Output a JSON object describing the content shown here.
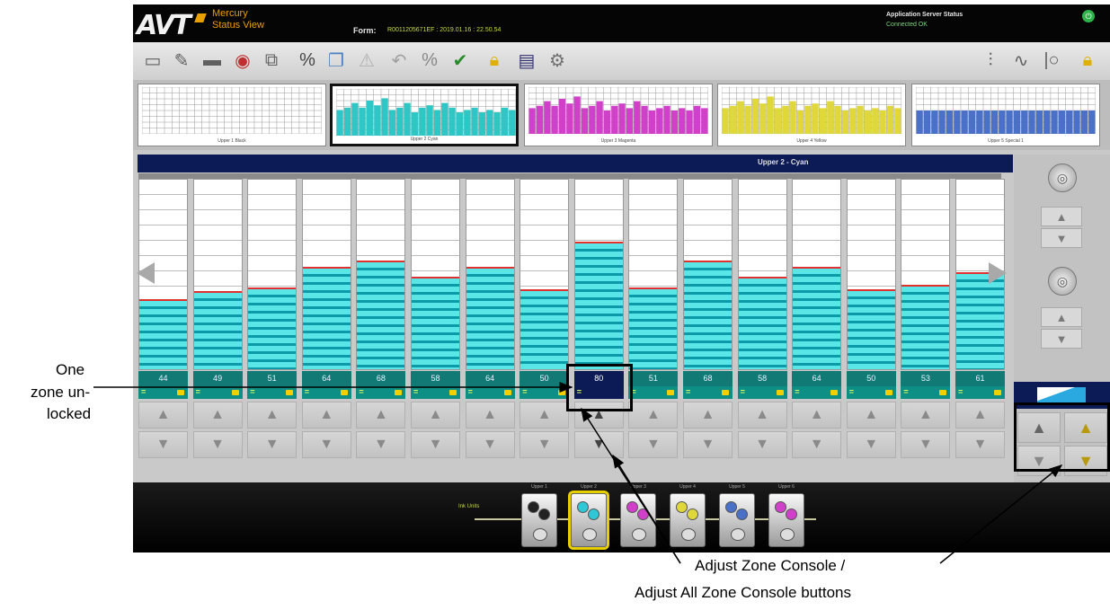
{
  "header": {
    "app_title_line1": "Mercury",
    "app_title_line2": "Status View",
    "form_label": "Form:",
    "form_value": "R0011205671EF : 2019.01.16 : 22.50.54",
    "server_status_title": "Application Server Status",
    "server_status_value": "Connected OK"
  },
  "toolbar": {
    "left_icons": [
      "new-doc-icon",
      "edit-icon",
      "save-icon",
      "record-icon",
      "export-icon",
      "percent-icon",
      "copy-icon",
      "warning-icon",
      "undo-icon",
      "percent-adjust-icon",
      "check-icon",
      "lock-icon",
      "ink-icon",
      "settings-icon"
    ],
    "right_icons": [
      "sliders-icon",
      "curve-icon",
      "io-icon",
      "lock-icon"
    ]
  },
  "thumbnails": [
    {
      "label": "Upper 1 Black",
      "color": "#444444"
    },
    {
      "label": "Upper 2 Cyan",
      "color": "#2fc6c6"
    },
    {
      "label": "Upper 3 Magenta",
      "color": "#d040c8"
    },
    {
      "label": "Upper 4 Yellow",
      "color": "#e0d83a"
    },
    {
      "label": "Upper 5 Special 1",
      "color": "#4a70c8"
    }
  ],
  "main": {
    "title": "Upper 2 - Cyan",
    "zones": [
      44,
      49,
      51,
      64,
      68,
      58,
      64,
      50,
      80,
      51,
      68,
      58,
      64,
      50,
      53,
      61
    ],
    "unlocked_zone_index": 8
  },
  "bottom": {
    "label": "Ink Units",
    "units": [
      {
        "label": "Upper 1",
        "colors": [
          "#222222",
          "#222222"
        ]
      },
      {
        "label": "Upper 2",
        "colors": [
          "#2fc6d6",
          "#2fc6d6"
        ]
      },
      {
        "label": "Upper 3",
        "colors": [
          "#d040c8",
          "#d040c8"
        ]
      },
      {
        "label": "Upper 4",
        "colors": [
          "#e0d83a",
          "#e0d83a"
        ]
      },
      {
        "label": "Upper 5",
        "colors": [
          "#4a70c8",
          "#4a70c8"
        ]
      },
      {
        "label": "Upper 6",
        "colors": [
          "#d040c8",
          "#d040c8"
        ]
      }
    ],
    "active_unit_index": 1
  },
  "annotations": {
    "one_zone_line1": "One",
    "one_zone_line2": "zone un-",
    "one_zone_line3": "locked",
    "console_line1": "Adjust Zone Console /",
    "console_line2": "Adjust All Zone Console buttons"
  }
}
